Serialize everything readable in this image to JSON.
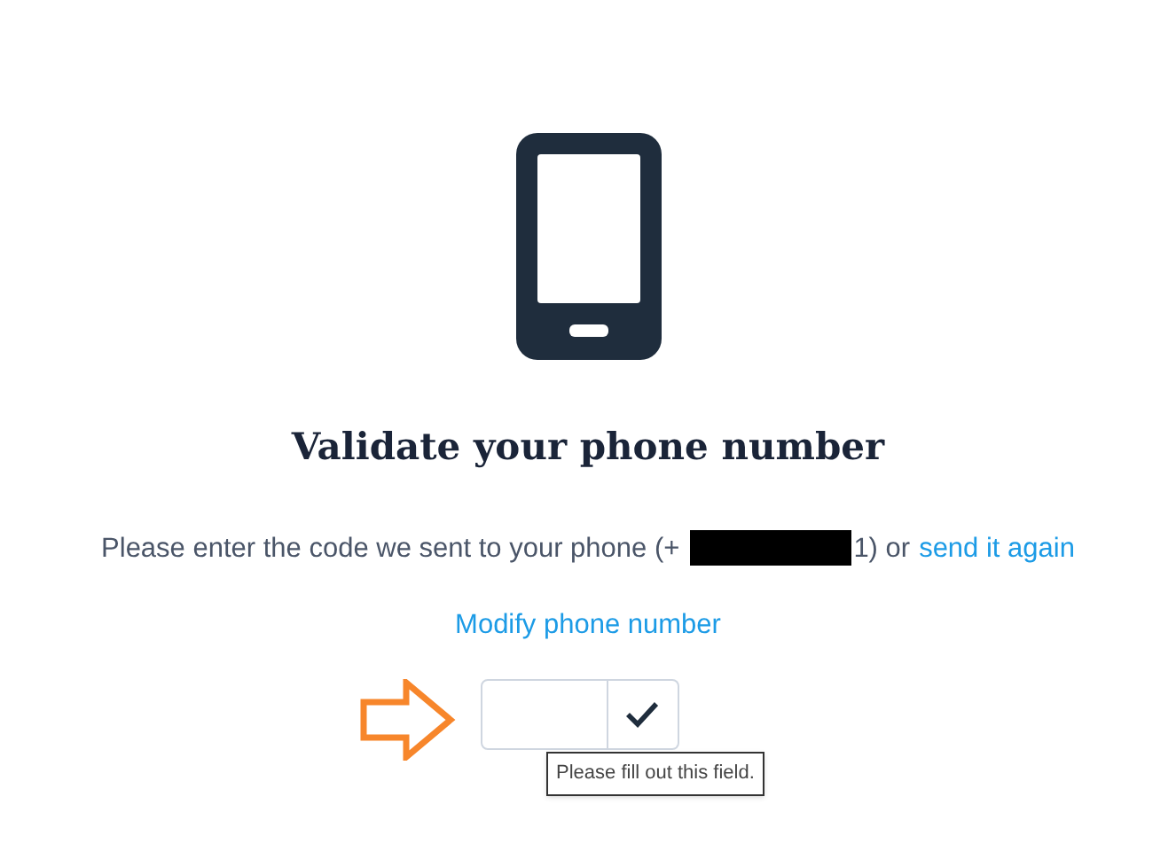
{
  "title": "Validate your phone number",
  "message": {
    "before": "Please enter the code we sent to your phone (+",
    "after": "1) or",
    "link": "send it again"
  },
  "modify_link": "Modify phone number",
  "tooltip": "Please fill out this field."
}
